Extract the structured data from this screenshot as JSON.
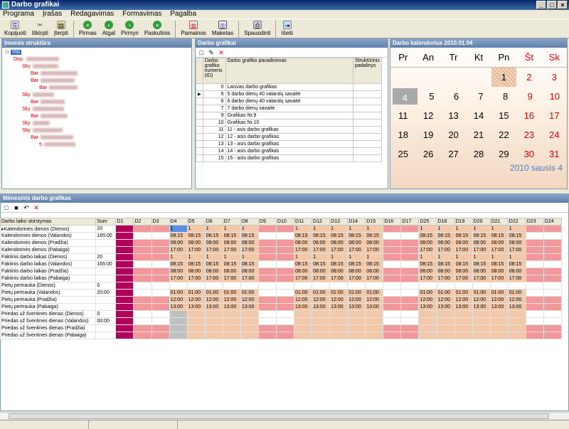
{
  "window": {
    "title": "Darbo grafikai"
  },
  "menu": [
    "Programa",
    "Įrašas",
    "Redagavimas",
    "Formavimas",
    "Pagalba"
  ],
  "toolbar": [
    {
      "label": "Kopijuoti",
      "icon": "copy-icon"
    },
    {
      "label": "Iškirpti",
      "icon": "cut-icon"
    },
    {
      "label": "Įterpti",
      "icon": "paste-icon"
    },
    {
      "label": "Pirmas",
      "icon": "first-icon"
    },
    {
      "label": "Atgal",
      "icon": "back-icon"
    },
    {
      "label": "Pirmyn",
      "icon": "forward-icon"
    },
    {
      "label": "Paskutinis",
      "icon": "last-icon"
    },
    {
      "label": "Pamainos",
      "icon": "shifts-icon"
    },
    {
      "label": "Maketas",
      "icon": "layout-icon"
    },
    {
      "label": "Spausdinti",
      "icon": "print-icon"
    },
    {
      "label": "Išeiti",
      "icon": "exit-icon"
    }
  ],
  "structure": {
    "title": "Įmonės struktūra",
    "root": "Visi",
    "nodes": [
      {
        "label": "Dep.",
        "level": 1
      },
      {
        "label": "Sky",
        "level": 2
      },
      {
        "label": "Bar",
        "level": 3
      },
      {
        "label": "Bar",
        "level": 3
      },
      {
        "label": "Bar",
        "level": 4
      },
      {
        "label": "Sky",
        "level": 2
      },
      {
        "label": "Bar",
        "level": 3
      },
      {
        "label": "Sky",
        "level": 2
      },
      {
        "label": "Bar",
        "level": 3
      },
      {
        "label": "Sky",
        "level": 2
      },
      {
        "label": "Sky",
        "level": 2
      },
      {
        "label": "Bar",
        "level": 3
      },
      {
        "label": "5",
        "level": 4
      }
    ]
  },
  "schedules": {
    "title": "Darbo grafikai",
    "columns": [
      "Darbo grafiko numeris (ID)",
      "Darbo grafiko pavadinimas",
      "Struktūrinis padalinys"
    ],
    "rows": [
      [
        "0",
        "Laisvas darbo grafikas"
      ],
      [
        "5",
        "5 darbo dienų 40 valandų savaitė"
      ],
      [
        "6",
        "6 darbo dienų 40 valandų savaitė"
      ],
      [
        "7",
        "7 darbo dienų savaitė"
      ],
      [
        "9",
        "Grafikas Nr.9"
      ],
      [
        "10",
        "Grafikas Nr.10"
      ],
      [
        "11",
        "11 - asis darbo grafikas"
      ],
      [
        "12",
        "12 - asis darbo grafikas"
      ],
      [
        "13",
        "13  - asis darbo grafikas"
      ],
      [
        "14",
        "14  - asis darbo grafikas"
      ],
      [
        "15",
        "15  - asis darbo grafikas"
      ]
    ]
  },
  "calendar": {
    "title": "Darbo kalendorius 2010.01.04",
    "days": [
      "Pr",
      "An",
      "Tr",
      "Kt",
      "Pn",
      "Št",
      "Sk"
    ],
    "weeks": [
      [
        "",
        "",
        "",
        "",
        "1",
        "2",
        "3"
      ],
      [
        "4",
        "5",
        "6",
        "7",
        "8",
        "9",
        "10"
      ],
      [
        "11",
        "12",
        "13",
        "14",
        "15",
        "16",
        "17"
      ],
      [
        "18",
        "19",
        "20",
        "21",
        "22",
        "23",
        "24"
      ],
      [
        "25",
        "26",
        "27",
        "28",
        "29",
        "30",
        "31"
      ]
    ],
    "footer": "2010 sausis 4"
  },
  "monthly": {
    "title": "Mėnesinis darbo grafikas",
    "header": [
      "Darbo laiko skirstymas",
      "Sum",
      "D1",
      "D2",
      "D3",
      "D4",
      "D5",
      "D6",
      "D7",
      "D8",
      "D9",
      "D10",
      "D11",
      "D12",
      "D13",
      "D14",
      "D15",
      "D16",
      "D17",
      "D25",
      "D18",
      "D19",
      "D20",
      "D21",
      "D22",
      "D23",
      "D24"
    ],
    "rows": [
      {
        "label": "Kalendorinės dienos (Dienos)",
        "sum": "20",
        "val": "1"
      },
      {
        "label": "Kalendorinės dienos (Valandos)",
        "sum": "165:00",
        "val": "08:15"
      },
      {
        "label": "Kalendorinės dienos (Pradžia)",
        "sum": "",
        "val": "08:00"
      },
      {
        "label": "Kalendorinės dienos (Pabaiga)",
        "sum": "",
        "val": "17:00"
      },
      {
        "label": "Faktinis darbo laikas (Dienos)",
        "sum": "20",
        "val": "1"
      },
      {
        "label": "Faktinis darbo laikas (Valandos)",
        "sum": "165:00",
        "val": "08:15"
      },
      {
        "label": "Faktinis darbo laikas (Pradžia)",
        "sum": "",
        "val": "08:00"
      },
      {
        "label": "Faktinis darbo laikas (Pabaiga)",
        "sum": "",
        "val": "17:00"
      },
      {
        "label": "Pietų pertrauka (Dienos)",
        "sum": "0",
        "val": ""
      },
      {
        "label": "Pietų pertrauka (Valandos)",
        "sum": "20:00",
        "val": "01:00"
      },
      {
        "label": "Pietų pertrauka (Pradžia)",
        "sum": "",
        "val": "12:00"
      },
      {
        "label": "Pietų pertrauka (Pabaiga)",
        "sum": "",
        "val": "13:00"
      },
      {
        "label": "Priedas už šventines dienas (Dienos)",
        "sum": "0",
        "val": ""
      },
      {
        "label": "Priedas už šventines dienas (Valandos)",
        "sum": "00:00",
        "val": ""
      },
      {
        "label": "Priedas už šventines dienas (Pradžia)",
        "sum": "",
        "val": ""
      },
      {
        "label": "Priedas už šventines dienas (Pabaiga)",
        "sum": "",
        "val": ""
      }
    ]
  }
}
